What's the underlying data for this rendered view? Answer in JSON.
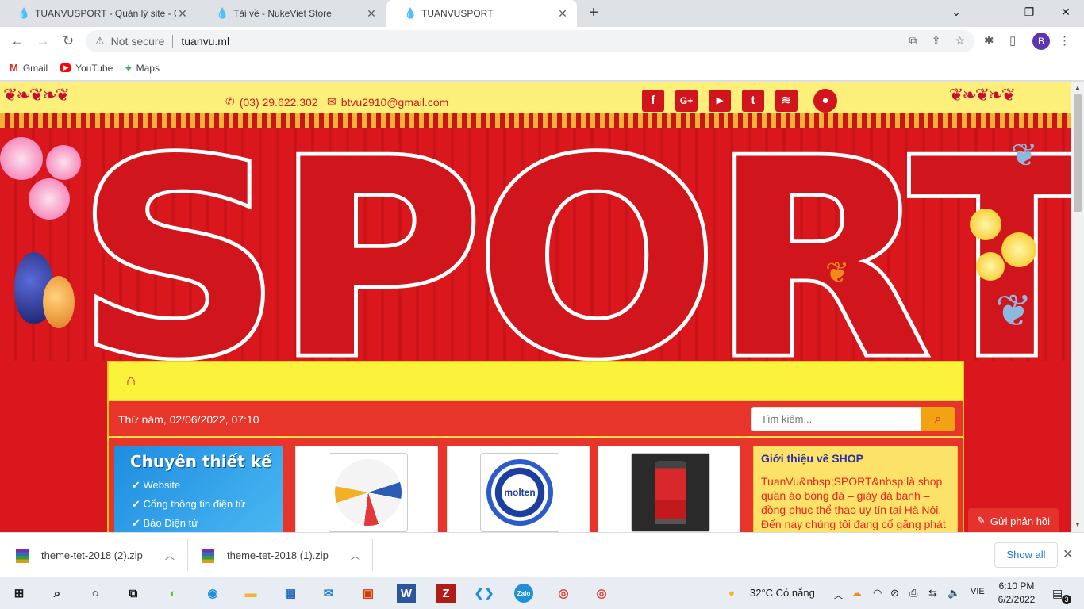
{
  "browser": {
    "tabs": [
      {
        "title": "TUANVUSPORT - Quản lý site - C",
        "active": false
      },
      {
        "title": "Tải về - NukeViet Store",
        "active": false
      },
      {
        "title": "TUANVUSPORT",
        "active": true
      }
    ],
    "security_label": "Not secure",
    "url": "tuanvu.ml",
    "profile_initial": "B",
    "bookmarks": [
      {
        "label": "Gmail",
        "icon": "gmail-icon"
      },
      {
        "label": "YouTube",
        "icon": "youtube-icon"
      },
      {
        "label": "Maps",
        "icon": "maps-icon"
      }
    ]
  },
  "site": {
    "phone": "(03) 29.622.302",
    "email": "btvu2910@gmail.com",
    "social": [
      {
        "label": "f",
        "icon": "facebook-icon"
      },
      {
        "label": "G+",
        "icon": "google-plus-icon"
      },
      {
        "label": "▶",
        "icon": "youtube-icon"
      },
      {
        "label": "t",
        "icon": "twitter-icon"
      },
      {
        "label": "≋",
        "icon": "rss-icon"
      }
    ],
    "banner_text": "SPORT",
    "date": "Thứ năm, 02/06/2022, 07:10",
    "search_placeholder": "Tìm kiếm...",
    "promo": {
      "heading": "Chuyên thiết kế",
      "items": [
        "Website",
        "Cổng thông tin điện tử",
        "Báo Điện tử"
      ]
    },
    "products": [
      {
        "name": "adidas ball",
        "brand": ""
      },
      {
        "name": "molten ball",
        "brand": "molten"
      },
      {
        "name": "red jersey",
        "brand": ""
      }
    ],
    "about": {
      "heading": "Giới thiệu về SHOP",
      "text": "TuanVu&nbsp;SPORT&nbsp;là shop quần áo bóng đá – giày đá banh – đồng phục thể thao uy tín tại Hà Nội. Đến nay chúng tôi đang cố gắng phát"
    },
    "feedback_label": "Gửi phản hồi"
  },
  "downloads": {
    "items": [
      "theme-tet-2018 (2).zip",
      "theme-tet-2018 (1).zip"
    ],
    "show_all": "Show all"
  },
  "taskbar": {
    "weather": "32°C  Có nắng",
    "lang": "VIE",
    "time": "6:10 PM",
    "date": "6/2/2022",
    "notifications": "3"
  },
  "colors": {
    "brand_red": "#d0161c",
    "banner_yellow": "#fdf07a",
    "accent_orange": "#f2a314",
    "about_heading": "#2b2fa0"
  }
}
